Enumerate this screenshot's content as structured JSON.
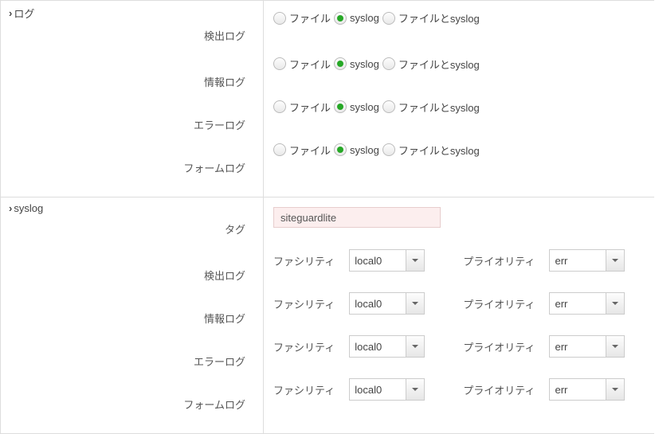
{
  "log": {
    "section_title": "ログ",
    "labels": {
      "detect": "検出ログ",
      "info": "情報ログ",
      "error": "エラーログ",
      "form": "フォームログ"
    },
    "options": {
      "file": "ファイル",
      "syslog": "syslog",
      "file_syslog": "ファイルとsyslog"
    },
    "selected": {
      "detect": "syslog",
      "info": "syslog",
      "error": "syslog",
      "form": "syslog"
    }
  },
  "syslog": {
    "section_title": "syslog",
    "labels": {
      "tag": "タグ",
      "detect": "検出ログ",
      "info": "情報ログ",
      "error": "エラーログ",
      "form": "フォームログ",
      "facility": "ファシリティ",
      "priority": "プライオリティ"
    },
    "tag_value": "siteguardlite",
    "rows": {
      "detect": {
        "facility": "local0",
        "priority": "err"
      },
      "info": {
        "facility": "local0",
        "priority": "err"
      },
      "error": {
        "facility": "local0",
        "priority": "err"
      },
      "form": {
        "facility": "local0",
        "priority": "err"
      }
    }
  }
}
